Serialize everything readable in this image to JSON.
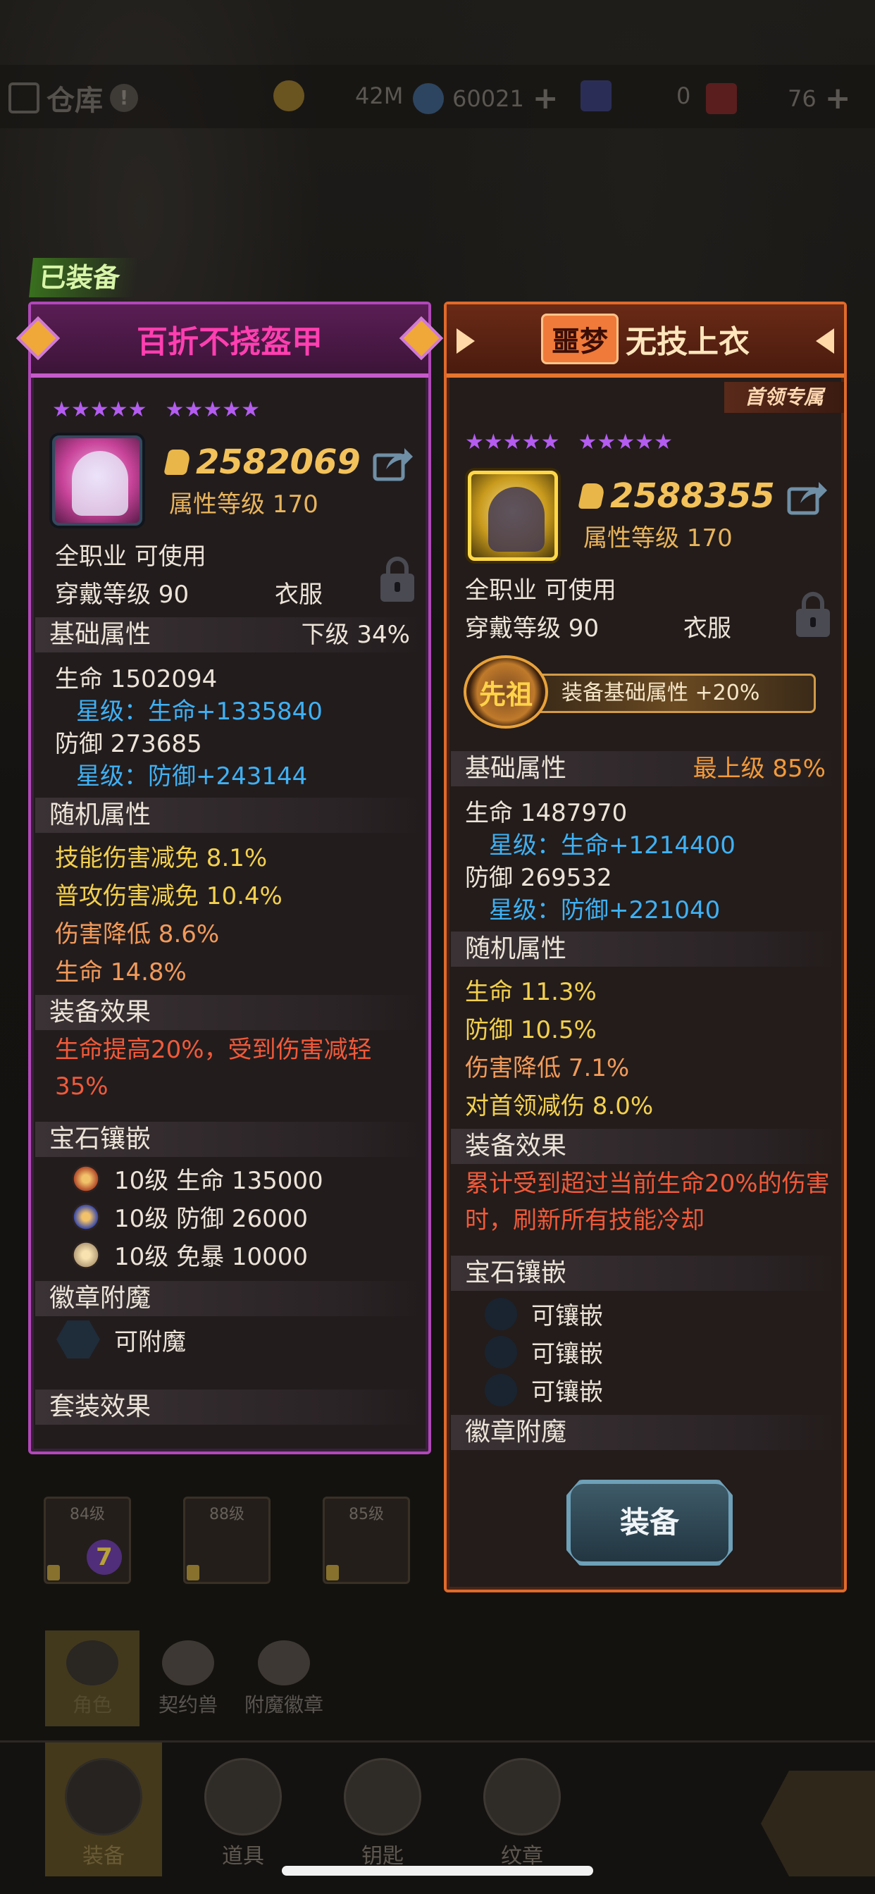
{
  "topbar": {
    "store_label": "仓库",
    "store_badge": "!",
    "gold": "42M",
    "crystal": "60021",
    "crystal_plus": "+",
    "ticket_blue": "0",
    "ticket_red": "76",
    "ticket_red_plus": "+"
  },
  "equipped_tag": "已装备",
  "left_card": {
    "name": "百折不挠盔甲",
    "stars_a": "★★★★★",
    "stars_b": "★★★★★",
    "power": "2582069",
    "attr_level": "属性等级 170",
    "class_line": "全职业 可使用",
    "wear_level": "穿戴等级 90",
    "slot_type": "衣服",
    "base_header": "基础属性",
    "base_grade": "下级 34%",
    "hp": "生命  1502094",
    "hp_star": "星级：生命+1335840",
    "def": "防御  273685",
    "def_star": "星级：防御+243144",
    "random_header": "随机属性",
    "random": [
      "技能伤害减免    8.1%",
      "普攻伤害减免    10.4%",
      "伤害降低    8.6%",
      "生命    14.8%"
    ],
    "effect_header": "装备效果",
    "effect_text": "生命提高20%，受到伤害减轻35%",
    "gem_header": "宝石镶嵌",
    "gems": [
      "10级    生命 135000",
      "10级    防御 26000",
      "10级    免暴 10000"
    ],
    "badge_header": "徽章附魔",
    "badge_text": "可附魔",
    "set_header": "套装效果"
  },
  "right_card": {
    "dream_badge": "噩梦",
    "name": "无技上衣",
    "boss_tag": "首领专属",
    "stars_a": "★★★★★",
    "stars_b": "★★★★★",
    "power": "2588355",
    "attr_level": "属性等级 170",
    "class_line": "全职业 可使用",
    "wear_level": "穿戴等级 90",
    "slot_type": "衣服",
    "ancestor_emblem": "先祖",
    "ancestor_text": "装备基础属性 +20%",
    "base_header": "基础属性",
    "base_grade": "最上级  85%",
    "hp": "生命  1487970",
    "hp_star": "星级：生命+1214400",
    "def": "防御  269532",
    "def_star": "星级：防御+221040",
    "random_header": "随机属性",
    "random": [
      "生命    11.3%",
      "防御    10.5%",
      "伤害降低    7.1%",
      "对首领减伤    8.0%"
    ],
    "effect_header": "装备效果",
    "effect_text": "累计受到超过当前生命20%的伤害时，刷新所有技能冷却",
    "gem_header": "宝石镶嵌",
    "gem_slot_text": "可镶嵌",
    "badge_header": "徽章附魔",
    "equip_button": "装备"
  },
  "inventory": {
    "slots": [
      "84级",
      "88级",
      "85级"
    ],
    "badge_7": "7"
  },
  "sub_tabs": [
    "角色",
    "契约兽",
    "附魔徽章"
  ],
  "bottom_nav": [
    "装备",
    "道具",
    "钥匙",
    "纹章"
  ],
  "colors": {
    "left_rarity": "#b048b8",
    "right_rarity": "#e06a2a",
    "star_purple": "#b45cf0",
    "star_stat_blue": "#3fb1f4",
    "random_yellow": "#f3d04e",
    "random_orange": "#f29a5a",
    "effect_red": "#f05a3a",
    "power_gold": "#f3c25a"
  }
}
